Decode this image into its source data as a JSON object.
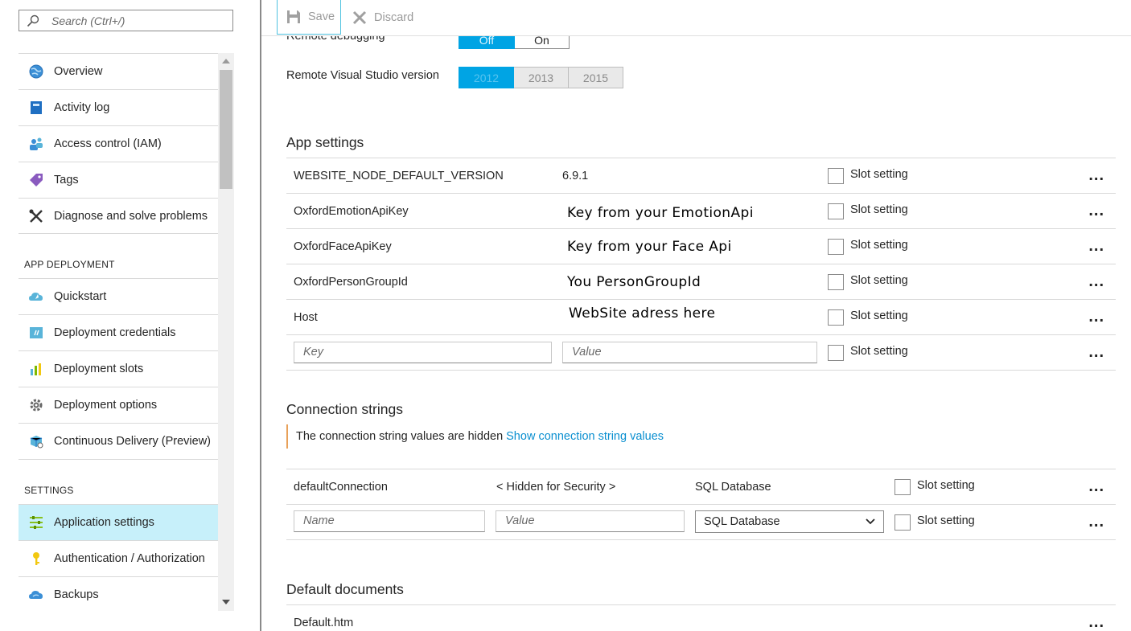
{
  "search": {
    "placeholder": "Search (Ctrl+/)"
  },
  "nav": {
    "top_items": [
      {
        "label": "Overview"
      },
      {
        "label": "Activity log"
      },
      {
        "label": "Access control (IAM)"
      },
      {
        "label": "Tags"
      },
      {
        "label": "Diagnose and solve problems"
      }
    ],
    "section_deploy": "APP DEPLOYMENT",
    "deploy_items": [
      {
        "label": "Quickstart"
      },
      {
        "label": "Deployment credentials"
      },
      {
        "label": "Deployment slots"
      },
      {
        "label": "Deployment options"
      },
      {
        "label": "Continuous Delivery (Preview)"
      }
    ],
    "section_settings": "SETTINGS",
    "settings_items": [
      {
        "label": "Application settings"
      },
      {
        "label": "Authentication / Authorization"
      },
      {
        "label": "Backups"
      }
    ]
  },
  "toolbar": {
    "save_label": "Save",
    "discard_label": "Discard"
  },
  "debug": {
    "remote_debugging_label": "Remote debugging",
    "off": "Off",
    "on": "On",
    "vs_label": "Remote Visual Studio version",
    "v2012": "2012",
    "v2013": "2013",
    "v2015": "2015"
  },
  "app_settings": {
    "heading": "App settings",
    "slot_label": "Slot setting",
    "dots": "...",
    "rows": [
      {
        "key": "WEBSITE_NODE_DEFAULT_VERSION",
        "value": "6.9.1"
      },
      {
        "key": "OxfordEmotionApiKey",
        "value": "Key from your EmotionApi"
      },
      {
        "key": "OxfordFaceApiKey",
        "value": "Key from your Face Api"
      },
      {
        "key": "OxfordPersonGroupId",
        "value": "You PersonGroupId"
      },
      {
        "key": "Host",
        "value": "WebSite adress here"
      }
    ],
    "key_placeholder": "Key",
    "value_placeholder": "Value"
  },
  "connection_strings": {
    "heading": "Connection strings",
    "info_text": "The connection string values are hidden",
    "info_link": "Show connection string values",
    "row": {
      "name": "defaultConnection",
      "value": "< Hidden for Security >",
      "type": "SQL Database"
    },
    "name_placeholder": "Name",
    "value_placeholder": "Value",
    "type_selected": "SQL Database"
  },
  "default_documents": {
    "heading": "Default documents",
    "first": "Default.htm"
  },
  "colors": {
    "accent": "#00a4e4",
    "active_nav": "#c7f0fa",
    "link": "#0a8fd0",
    "info_bar": "#e8a15a"
  }
}
